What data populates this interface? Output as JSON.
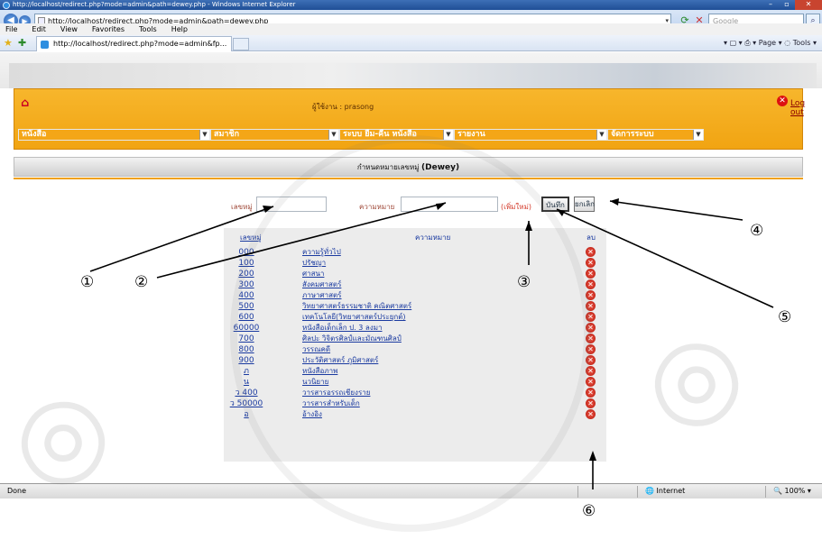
{
  "browser": {
    "title": "http://localhost/redirect.php?mode=admin&path=dewey.php - Windows Internet Explorer",
    "url": "http://localhost/redirect.php?mode=admin&path=dewey.php",
    "search_placeholder": "Google",
    "menu": [
      "File",
      "Edit",
      "View",
      "Favorites",
      "Tools",
      "Help"
    ],
    "tab_title": "http://localhost/redirect.php?mode=admin&fp...",
    "tools_text": "▾ ▢ ▾ ⎙ ▾ Page ▾ ◌ Tools ▾",
    "status_text": "Done",
    "zone_text": "Internet",
    "zoom_text": "100%"
  },
  "app": {
    "user_label": "ผู้ใช้งาน : prasong",
    "logout_label": "Log out",
    "menus": [
      "หนังสือ",
      "สมาชิก",
      "ระบบ ยืม-คืน หนังสือ",
      "รายงาน",
      "จัดการระบบ"
    ],
    "page_title_prefix": "กำหนดหมายเลขหมู่",
    "page_title_suffix": "(Dewey)"
  },
  "form": {
    "code_label": "เลขหมู่",
    "meaning_label": "ความหมาย",
    "add_new": "(เพิ่มใหม่)",
    "save_button": "บันทึก",
    "cancel_button": "ยกเลิก"
  },
  "table": {
    "headers": {
      "code": "เลขหมู่",
      "meaning": "ความหมาย",
      "delete": "ลบ"
    },
    "rows": [
      {
        "code": "000",
        "desc": "ความรู้ทั่วไป"
      },
      {
        "code": "100",
        "desc": "ปรัชญา"
      },
      {
        "code": "200",
        "desc": "ศาสนา"
      },
      {
        "code": "300",
        "desc": "สังคมศาสตร์"
      },
      {
        "code": "400",
        "desc": "ภาษาศาสตร์"
      },
      {
        "code": "500",
        "desc": "วิทยาศาสตร์ธรรมชาติ คณิตศาสตร์"
      },
      {
        "code": "600",
        "desc": "เทคโนโลยี(วิทยาศาสตร์ประยุกต์)"
      },
      {
        "code": "60000",
        "desc": "หนังสือเด็กเล็ก ป. 3 ลงมา"
      },
      {
        "code": "700",
        "desc": "ศิลปะ วิจิตรศิลป์และมัณฑนศิลป์"
      },
      {
        "code": "800",
        "desc": "วรรณคดี"
      },
      {
        "code": "900",
        "desc": "ประวัติศาสตร์ ภูมิศาสตร์"
      },
      {
        "code": "ภ",
        "desc": "หนังสือภาพ"
      },
      {
        "code": "น",
        "desc": "นวนิยาย"
      },
      {
        "code": "ว 400",
        "desc": "วารสารอรรถเชียงราย"
      },
      {
        "code": "ว 50000",
        "desc": "วารสารสำหรับเด็ก"
      },
      {
        "code": "อ",
        "desc": "อ้างอิง"
      }
    ]
  },
  "annotations": [
    "①",
    "②",
    "③",
    "④",
    "⑤",
    "⑥"
  ]
}
